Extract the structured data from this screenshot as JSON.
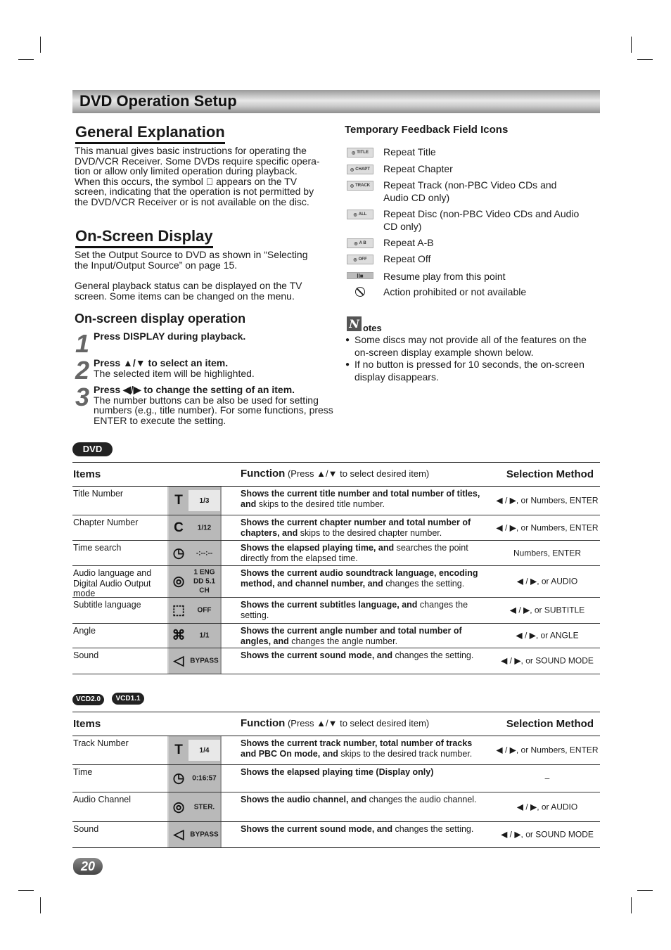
{
  "header": {
    "title": "DVD Operation Setup"
  },
  "general": {
    "heading": "General Explanation",
    "lines": [
      "This manual gives basic instructions for operating the",
      "DVD/VCR Receiver. Some DVDs require specific opera-",
      "tion or allow only limited operation during playback.",
      "When this occurs, the symbol ⃠ appears on the TV",
      "screen, indicating that the operation is not permitted by",
      "the DVD/VCR Receiver or is not available on the disc."
    ]
  },
  "osd": {
    "heading": "On-Screen Display",
    "para1": [
      "Set the Output Source to DVD as shown in “Selecting",
      "the Input/Output Source” on page 15."
    ],
    "para2": [
      "General playback status can be displayed on the TV",
      "screen. Some items can be changed on the menu."
    ],
    "subheading": "On-screen display operation",
    "steps": [
      {
        "num": "1",
        "bold": "Press DISPLAY during playback.",
        "text": ""
      },
      {
        "num": "2",
        "bold": "Press ▲/▼ to select an item.",
        "text": "The selected item will be highlighted."
      },
      {
        "num": "3",
        "bold": "Press ◀/▶ to change the setting of an item.",
        "text": "The number buttons can be also be used for setting numbers (e.g., title number). For some functions, press ENTER to execute the setting."
      }
    ]
  },
  "feedback": {
    "heading": "Temporary Feedback Field Icons",
    "items": [
      {
        "icon": "repeat-title-icon",
        "tag": "TITLE",
        "label": "Repeat Title"
      },
      {
        "icon": "repeat-chapter-icon",
        "tag": "CHAPT",
        "label": "Repeat Chapter"
      },
      {
        "icon": "repeat-track-icon",
        "tag": "TRACK",
        "label": "Repeat Track (non-PBC Video CDs and Audio CD only)"
      },
      {
        "icon": "repeat-all-icon",
        "tag": "ALL",
        "label": "Repeat Disc (non-PBC Video CDs and Audio CD only)"
      },
      {
        "icon": "repeat-ab-icon",
        "tag": "A  B",
        "label": "Repeat A-B"
      },
      {
        "icon": "repeat-off-icon",
        "tag": "OFF",
        "label": "Repeat Off"
      },
      {
        "icon": "resume-icon",
        "tag": "II■",
        "label": "Resume play from this point"
      },
      {
        "icon": "prohibited-icon",
        "tag": "⌀",
        "label": "Action prohibited or not available"
      }
    ]
  },
  "notes": {
    "icon_letter": "N",
    "label": "otes",
    "items": [
      "Some discs may not provide all of the features on the on-screen display example shown below.",
      "If no button is pressed for 10 seconds, the on-screen display disappears."
    ]
  },
  "dvd_table": {
    "badge": "DVD",
    "header": {
      "items": "Items",
      "function": "Function",
      "function_note": "(Press ▲/▼ to select desired item)",
      "selection": "Selection Method"
    },
    "rows": [
      {
        "item": "Title Number",
        "icon": "title-icon",
        "glyph": "T",
        "value": "1/3",
        "func_bold": "Shows the current title number and total number of titles, and",
        "func_rest": " skips to the desired title number.",
        "sel": "◀ / ▶, or Numbers, ENTER"
      },
      {
        "item": "Chapter Number",
        "icon": "chapter-icon",
        "glyph": "C",
        "value": "1/12",
        "func_bold": "Shows the current chapter number and total number of chapters, and",
        "func_rest": " skips to the desired chapter number.",
        "sel": "◀ / ▶, or Numbers, ENTER"
      },
      {
        "item": "Time search",
        "icon": "clock-icon",
        "glyph": "◷",
        "value": "-:--:--",
        "func_bold": "Shows the elapsed playing time, and",
        "func_rest": " searches the point directly from the elapsed time.",
        "sel": "Numbers, ENTER"
      },
      {
        "item": "Audio language and Digital Audio Output mode",
        "icon": "audio-icon",
        "glyph": "◎",
        "value": "1 ENG DD 5.1 CH",
        "func_bold": "Shows the current audio soundtrack language, encoding method, and channel number, and",
        "func_rest": " changes the setting.",
        "sel": "◀ / ▶, or AUDIO"
      },
      {
        "item": "Subtitle language",
        "icon": "subtitle-icon",
        "glyph": "⬚",
        "value": "OFF",
        "func_bold": "Shows the current subtitles language, and",
        "func_rest": " changes the setting.",
        "sel": "◀ / ▶, or SUBTITLE"
      },
      {
        "item": "Angle",
        "icon": "camera-angle-icon",
        "glyph": "⌘",
        "value": "1/1",
        "func_bold": "Shows the current angle number and total number of angles, and",
        "func_rest": " changes the angle number.",
        "sel": "◀ / ▶, or ANGLE"
      },
      {
        "item": "Sound",
        "icon": "speaker-icon",
        "glyph": "◁",
        "value": "BYPASS",
        "func_bold": "Shows the current sound mode, and",
        "func_rest": " changes the setting.",
        "sel": "◀ / ▶, or SOUND MODE"
      }
    ]
  },
  "vcd_table": {
    "badges": [
      "VCD2.0",
      "VCD1.1"
    ],
    "header": {
      "items": "Items",
      "function": "Function",
      "function_note": "(Press ▲/▼ to select desired item)",
      "selection": "Selection Method"
    },
    "rows": [
      {
        "item": "Track Number",
        "icon": "track-icon",
        "glyph": "T",
        "value": "1/4",
        "func_bold": "Shows the current track number, total number of tracks and PBC On mode, and",
        "func_rest": " skips to the desired track number.",
        "sel": "◀ / ▶, or Numbers, ENTER"
      },
      {
        "item": "Time",
        "icon": "clock-icon",
        "glyph": "◷",
        "value": "0:16:57",
        "func_bold": "Shows the elapsed playing time (Display only)",
        "func_rest": "",
        "sel": "–"
      },
      {
        "item": "Audio Channel",
        "icon": "audio-icon",
        "glyph": "◎",
        "value": "STER.",
        "func_bold": "Shows the audio channel, and",
        "func_rest": " changes the audio channel.",
        "sel": "◀ / ▶, or AUDIO"
      },
      {
        "item": "Sound",
        "icon": "speaker-icon",
        "glyph": "◁",
        "value": "BYPASS",
        "func_bold": "Shows the current sound mode, and",
        "func_rest": " changes the setting.",
        "sel": "◀ / ▶, or SOUND MODE"
      }
    ]
  },
  "footer": {
    "page_number": "20"
  }
}
